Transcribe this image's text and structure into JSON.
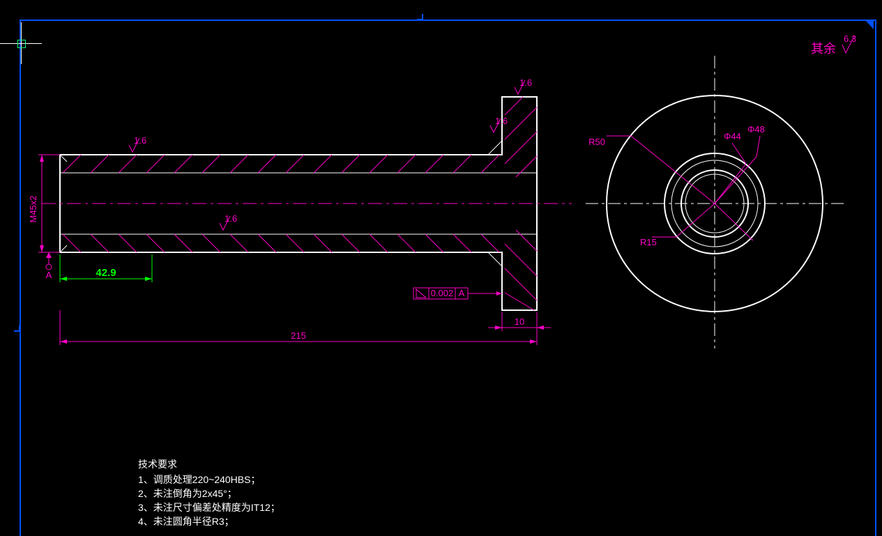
{
  "frame": {
    "outer": true
  },
  "surface_note": {
    "label": "其余",
    "symbol": "6.3"
  },
  "dimensions": {
    "thread": "M45x2",
    "length_total": "215",
    "length_thread_green": "42.9",
    "flange_thk": "10",
    "surf_finish_small": "1.6",
    "tol_perp": "0.002",
    "tol_datum": "A",
    "d_R50": "R50",
    "d_phi44": "Φ44",
    "d_phi48": "Φ48",
    "d_R15": "R15"
  },
  "notes": {
    "title": "技术要求",
    "lines": [
      "1、调质处理220~240HBS；",
      "2、未注倒角为2x45°；",
      "3、未注尺寸偏差处精度为IT12；",
      "4、未注圆角半径R3；"
    ]
  },
  "colors": {
    "magenta": "#ff00c8",
    "blue": "#0050ff",
    "green": "#00ff00",
    "white": "#ffffff"
  }
}
